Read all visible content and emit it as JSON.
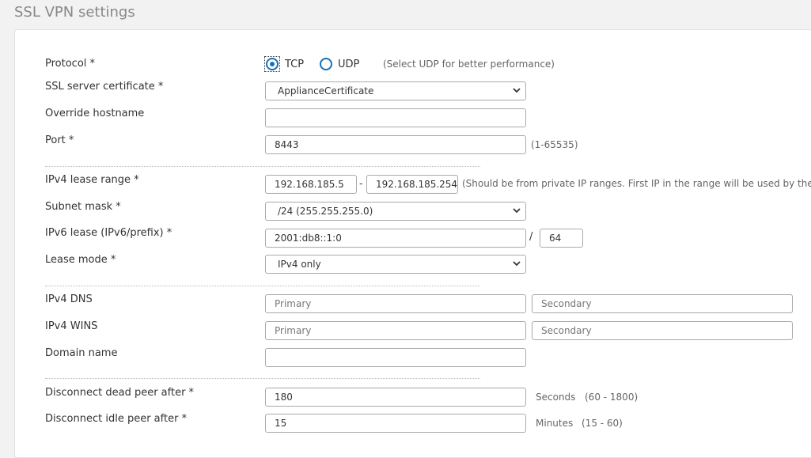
{
  "page": {
    "title": "SSL VPN settings"
  },
  "protocol": {
    "label": "Protocol *",
    "options": [
      {
        "label": "TCP",
        "selected": true
      },
      {
        "label": "UDP",
        "selected": false
      }
    ],
    "hint": "(Select UDP for better performance)"
  },
  "certificate": {
    "label": "SSL server certificate *",
    "value": "ApplianceCertificate"
  },
  "hostname": {
    "label": "Override hostname",
    "value": ""
  },
  "port": {
    "label": "Port *",
    "value": "8443",
    "hint": "(1-65535)"
  },
  "ipv4_lease": {
    "label": "IPv4 lease range *",
    "start": "192.168.185.5",
    "end": "192.168.185.254",
    "separator": "-",
    "hint": "(Should be from private IP ranges. First IP in the range will be used by the s"
  },
  "subnet": {
    "label": "Subnet mask *",
    "value": "/24 (255.255.255.0)"
  },
  "ipv6_lease": {
    "label": "IPv6 lease (IPv6/prefix) *",
    "address": "2001:db8::1:0",
    "separator": "/",
    "prefix": "64"
  },
  "lease_mode": {
    "label": "Lease mode *",
    "value": "IPv4 only"
  },
  "ipv4_dns": {
    "label": "IPv4 DNS",
    "primary_placeholder": "Primary",
    "secondary_placeholder": "Secondary"
  },
  "ipv4_wins": {
    "label": "IPv4 WINS",
    "primary_placeholder": "Primary",
    "secondary_placeholder": "Secondary"
  },
  "domain": {
    "label": "Domain name",
    "value": ""
  },
  "dead_peer": {
    "label": "Disconnect dead peer after *",
    "value": "180",
    "unit": "Seconds",
    "range": "(60 - 1800)"
  },
  "idle_peer": {
    "label": "Disconnect idle peer after *",
    "value": "15",
    "unit": "Minutes",
    "range": "(15 - 60)"
  },
  "colors": {
    "accent": "#1b6fb5",
    "border": "#aaaaaa",
    "background": "#f2f2f2"
  },
  "icons": {
    "select_arrow": "chevron-down-icon"
  }
}
